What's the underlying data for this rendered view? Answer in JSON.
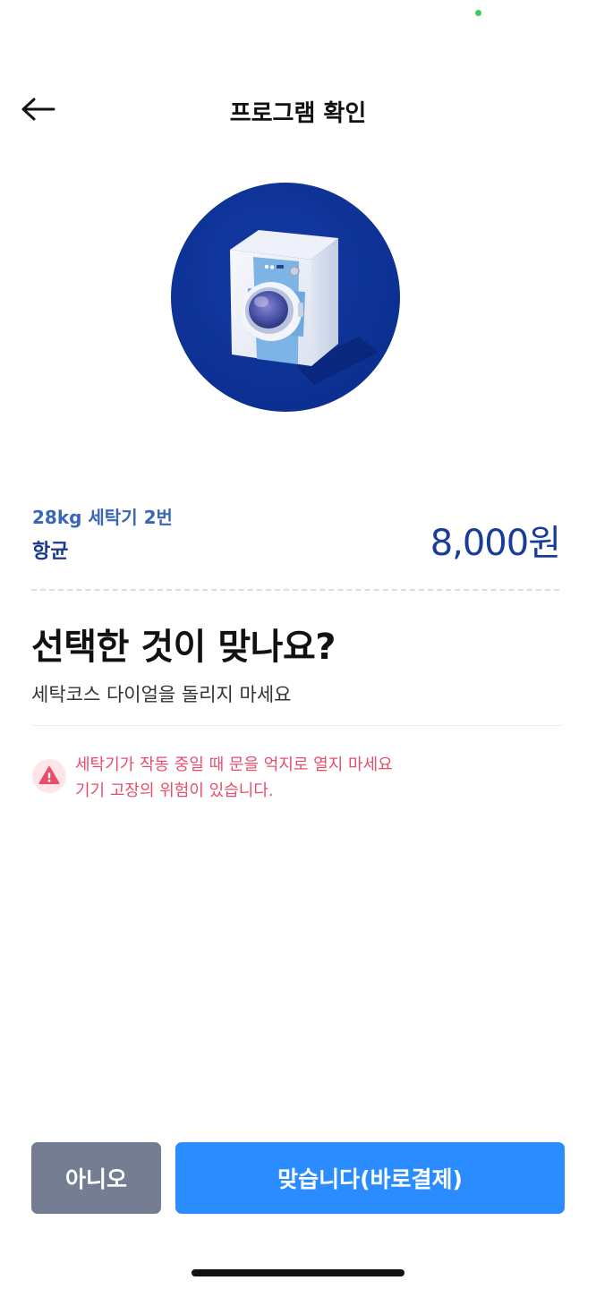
{
  "header": {
    "title": "프로그램 확인"
  },
  "machine": {
    "name": "28kg 세탁기 2번",
    "program": "항균",
    "price": "8,000원"
  },
  "confirm": {
    "question": "선택한 것이 맞나요?",
    "instruction": "세탁코스 다이얼을 돌리지 마세요"
  },
  "warning": {
    "line1": "세탁기가 작동 중일 때 문을 억지로 열지 마세요",
    "line2": "기기 고장의 위험이 있습니다."
  },
  "actions": {
    "no_label": "아니오",
    "yes_label": "맞습니다(바로결제)"
  },
  "colors": {
    "primary": "#2b8cff",
    "secondary": "#757d92",
    "warning": "#e84d6a",
    "brand_navy": "#173d99"
  }
}
